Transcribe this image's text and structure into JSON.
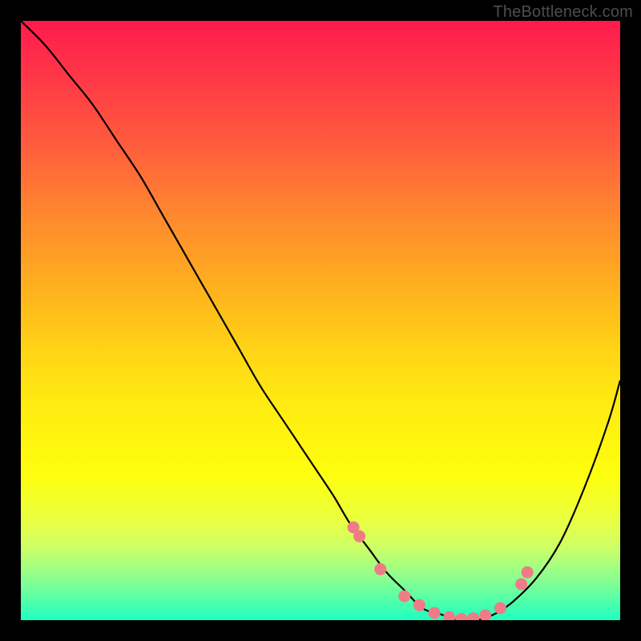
{
  "attribution": "TheBottleneck.com",
  "colors": {
    "curve_stroke": "#000000",
    "marker_fill": "#ef7b87",
    "marker_stroke": "#ef7b87",
    "frame": "#000000"
  },
  "chart_data": {
    "type": "line",
    "title": "",
    "xlabel": "",
    "ylabel": "",
    "xlim": [
      0,
      100
    ],
    "ylim": [
      0,
      100
    ],
    "series": [
      {
        "name": "bottleneck-curve",
        "x": [
          0,
          4,
          8,
          12,
          16,
          20,
          24,
          28,
          32,
          36,
          40,
          44,
          48,
          52,
          55,
          58,
          61,
          64,
          67,
          70,
          73,
          76,
          79,
          82,
          86,
          90,
          94,
          98,
          100
        ],
        "y": [
          100,
          96,
          91,
          86,
          80,
          74,
          67,
          60,
          53,
          46,
          39,
          33,
          27,
          21,
          16,
          12,
          8,
          5,
          2,
          1,
          0,
          0,
          1,
          3,
          7,
          13,
          22,
          33,
          40
        ]
      }
    ],
    "markers": {
      "name": "highlight-dots",
      "x": [
        55.5,
        56.5,
        60.0,
        64.0,
        66.5,
        69.0,
        71.5,
        73.5,
        75.5,
        77.5,
        80.0,
        83.5,
        84.5
      ],
      "y": [
        15.5,
        14.0,
        8.5,
        4.0,
        2.5,
        1.2,
        0.5,
        0.2,
        0.3,
        0.8,
        2.0,
        6.0,
        8.0
      ]
    }
  }
}
